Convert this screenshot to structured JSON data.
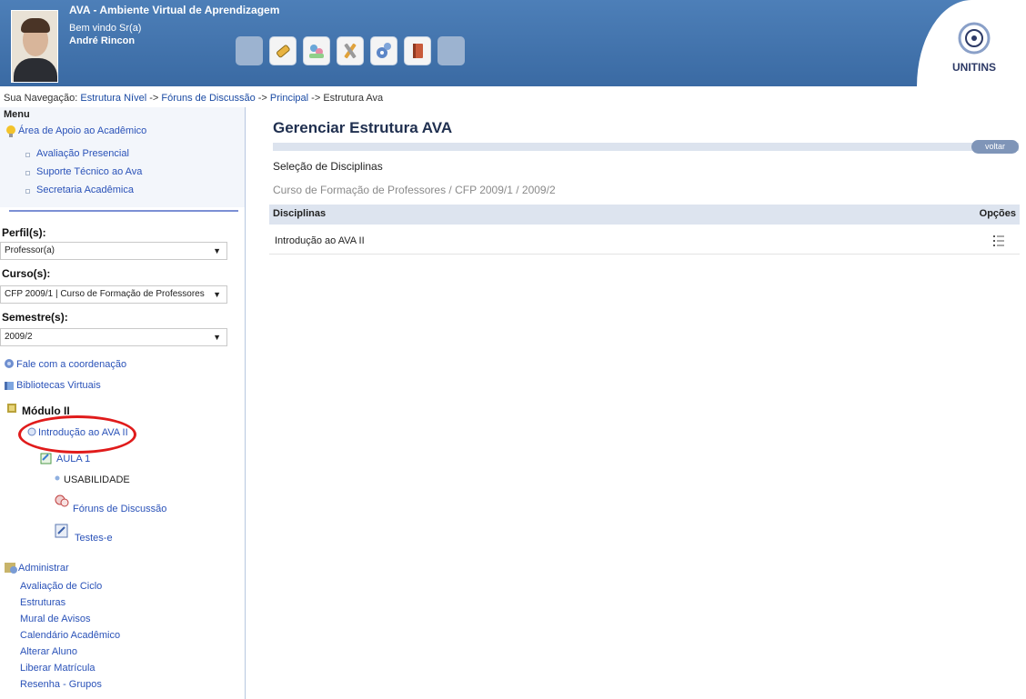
{
  "header": {
    "app_title": "AVA - Ambiente Virtual de Aprendizagem",
    "welcome": "Bem vindo Sr(a)",
    "user_name": "André Rincon",
    "logo_text": "UNITINS",
    "toolbar": [
      "pencil-icon",
      "people-icon",
      "tools-icon",
      "gears-icon",
      "book-icon"
    ]
  },
  "breadcrumb": {
    "prefix": "Sua Navegação:",
    "items": [
      "Estrutura Nível",
      "Fóruns de Discussão",
      "Principal"
    ],
    "separator": "->",
    "current": "Estrutura Ava"
  },
  "sidebar": {
    "menu_title": "Menu",
    "support_title": "Área de Apoio ao Acadêmico",
    "support_items": [
      "Avaliação Presencial",
      "Suporte Técnico ao Ava",
      "Secretaria Acadêmica"
    ],
    "perfil_label": "Perfil(s):",
    "perfil_value": "Professor(a)",
    "curso_label": "Curso(s):",
    "curso_value": "CFP 2009/1 | Curso de Formação de Professores",
    "semestre_label": "Semestre(s):",
    "semestre_value": "2009/2",
    "fale": "Fale com a coordenação",
    "bibliotecas": "Bibliotecas Virtuais",
    "modulo": "Módulo II",
    "disciplina": "Introdução ao AVA II",
    "aula": "AULA 1",
    "usabilidade": "USABILIDADE",
    "foruns": "Fóruns de Discussão",
    "testes": "Testes-e",
    "admin_title": "Administrar",
    "admin_items": [
      "Avaliação de Ciclo",
      "Estruturas",
      "Mural de Avisos",
      "Calendário Acadêmico",
      "Alterar Aluno",
      "Liberar Matrícula",
      "Resenha - Grupos"
    ]
  },
  "main": {
    "title": "Gerenciar Estrutura AVA",
    "voltar": "voltar",
    "selection_title": "Seleção de Disciplinas",
    "course_path": "Curso de Formação de Professores / CFP 2009/1 / 2009/2",
    "table": {
      "headers": [
        "Disciplinas",
        "Opções"
      ],
      "rows": [
        [
          "Introdução ao AVA II"
        ]
      ]
    }
  },
  "colors": {
    "header_blue": "#3f70aa",
    "link_blue": "#2a52b8",
    "highlight_red": "#e01b1b"
  }
}
